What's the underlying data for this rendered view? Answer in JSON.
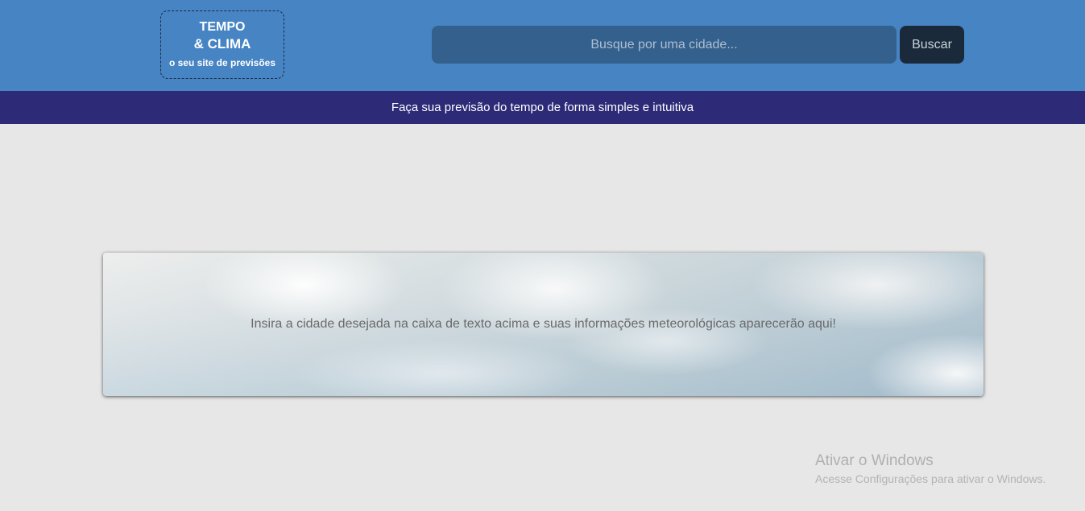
{
  "header": {
    "logo": {
      "line1": "TEMPO",
      "line2": "& CLIMA",
      "line3": "o seu site de previsões"
    },
    "search": {
      "placeholder": "Busque por uma cidade...",
      "value": "",
      "button_label": "Buscar"
    }
  },
  "tagline": "Faça sua previsão do tempo de forma simples e intuitiva",
  "main": {
    "message": "Insira a cidade desejada na caixa de texto acima e suas informações meteorológicas aparecerão aqui!"
  },
  "watermark": {
    "title": "Ativar o Windows",
    "subtitle": "Acesse Configurações para ativar o Windows."
  },
  "colors": {
    "header_bg": "#4784c4",
    "search_bg": "#33608c",
    "button_bg": "#1b2a3a",
    "tagline_bg": "#2d2a78",
    "page_bg": "#e7e7e7"
  }
}
